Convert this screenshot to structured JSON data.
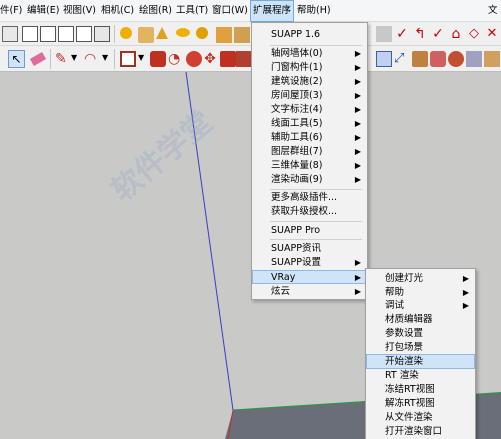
{
  "menubar": {
    "items": [
      "件(F)",
      "编辑(E)",
      "视图(V)",
      "相机(C)",
      "绘图(R)",
      "工具(T)",
      "窗口(W)",
      "扩展程序",
      "帮助(H)"
    ],
    "right_label": "文"
  },
  "extensions_menu": {
    "items": [
      {
        "label": "SUAPP 1.6"
      },
      {
        "label": "轴网墙体(0)"
      },
      {
        "label": "门窗构件(1)"
      },
      {
        "label": "建筑设施(2)"
      },
      {
        "label": "房间屋顶(3)"
      },
      {
        "label": "文字标注(4)"
      },
      {
        "label": "线面工具(5)"
      },
      {
        "label": "辅助工具(6)"
      },
      {
        "label": "图层群组(7)"
      },
      {
        "label": "三维体量(8)"
      },
      {
        "label": "渲染动画(9)"
      },
      {
        "label": "更多高级插件..."
      },
      {
        "label": "获取升级授权..."
      },
      {
        "label": "SUAPP Pro"
      },
      {
        "label": "SUAPP资讯"
      },
      {
        "label": "SUAPP设置"
      },
      {
        "label": "VRay"
      },
      {
        "label": "炫云"
      }
    ]
  },
  "vray_menu": {
    "items": [
      {
        "label": "创建灯光"
      },
      {
        "label": "帮助"
      },
      {
        "label": "调试"
      },
      {
        "label": "材质编辑器"
      },
      {
        "label": "参数设置"
      },
      {
        "label": "打包场景"
      },
      {
        "label": "开始渲染"
      },
      {
        "label": "RT 渲染"
      },
      {
        "label": "冻结RT视图"
      },
      {
        "label": "解冻RT视图"
      },
      {
        "label": "从文件渲染"
      },
      {
        "label": "打开渲染窗口"
      }
    ]
  },
  "watermark": {
    "text": "软件学堂"
  },
  "colors": {
    "axis_blue": "#3a3ad0",
    "axis_green": "#1f9e3a",
    "highlight": "#cfe4f8"
  },
  "icons": [
    "paint-bucket-icon",
    "eraser-icon",
    "pencil-icon",
    "arc-icon",
    "rectangle-icon",
    "circle-icon",
    "move-icon",
    "rotate-icon",
    "scale-icon",
    "orbit-icon",
    "select-arrow-icon",
    "tape-icon",
    "dimension-icon",
    "materials-icon",
    "components-icon"
  ]
}
